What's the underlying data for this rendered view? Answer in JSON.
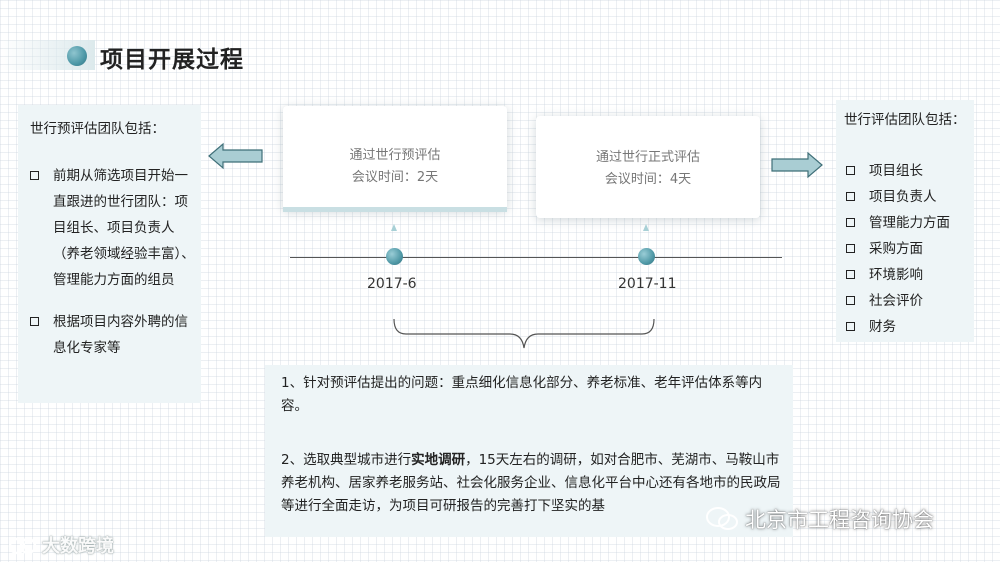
{
  "slide": {
    "title": "项目开展过程"
  },
  "left_panel": {
    "heading": "世行预评估团队包括：",
    "items": [
      "前期从筛选项目开始一直跟进的世行团队：项目组长、项目负责人（养老领域经验丰富）、管理能力方面的组员",
      "根据项目内容外聘的信息化专家等"
    ]
  },
  "right_panel": {
    "heading": "世行评估团队包括：",
    "items": [
      "项目组长",
      "项目负责人",
      "管理能力方面",
      "采购方面",
      "环境影响",
      "社会评价",
      "财务"
    ]
  },
  "cards": [
    {
      "title": "通过世行预评估",
      "duration": "会议时间：2天"
    },
    {
      "title": "通过世行正式评估",
      "duration": "会议时间：4天"
    }
  ],
  "timeline": {
    "dates": [
      "2017-6",
      "2017-11"
    ]
  },
  "description": {
    "para1": "1、针对预评估提出的问题：重点细化信息化部分、养老标准、老年评估体系等内容。",
    "para2_prefix": "2、选取典型城市进行",
    "para2_bold": "实地调研",
    "para2_suffix": "，15天左右的调研，如对合肥市、芜湖市、马鞍山市养老机构、居家养老服务站、社会化服务企业、信息化平台中心还有各地市的民政局等进行全面走访，为项目可研报告的完善打下坚实的基"
  },
  "watermarks": {
    "left": "大数跨境",
    "right": "北京市工程咨询协会"
  },
  "colors": {
    "accent": "#4c97a6",
    "panel_bg": "#eef5f7",
    "arrow_fill": "#a9cdd3"
  }
}
